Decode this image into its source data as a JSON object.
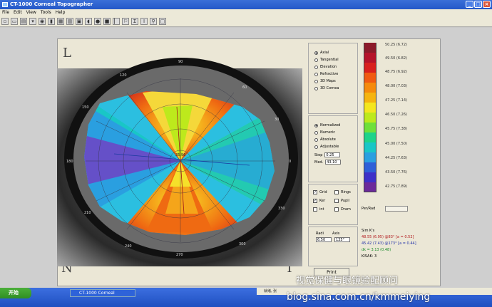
{
  "window": {
    "title": "CT-1000 Corneal Topographer"
  },
  "menu": [
    "File",
    "Edit",
    "View",
    "Tools",
    "Help"
  ],
  "corners": {
    "top_left": "L",
    "bottom_left": "N",
    "bottom_right": "T"
  },
  "map": {
    "axis_labels": [
      "90",
      "60",
      "30",
      "0",
      "330",
      "300",
      "270",
      "240",
      "210",
      "180",
      "150",
      "120"
    ],
    "center_label": "35.96"
  },
  "map_type": {
    "options": [
      "Axial",
      "Tangential",
      "Elevation",
      "Refractive",
      "3D Maps",
      "3D Cornea"
    ],
    "selected": "Axial"
  },
  "scale_type": {
    "options": [
      "Normalized",
      "Numeric",
      "Absolute",
      "Adjustable"
    ],
    "selected": "Normalized",
    "step_label": "Step",
    "step_value": "0.25",
    "med_label": "Med.",
    "med_value": "43.10"
  },
  "overlays": {
    "items": [
      {
        "label": "Grid",
        "checked": true
      },
      {
        "label": "Rings",
        "checked": false
      },
      {
        "label": "Ker",
        "checked": true
      },
      {
        "label": "Pupil",
        "checked": false
      },
      {
        "label": "int",
        "checked": false
      },
      {
        "label": "Dram",
        "checked": false
      }
    ]
  },
  "radi_axis": {
    "radi_label": "Radi",
    "axis_label": "Axis",
    "radi_value": "6.50",
    "axis_value": "135°"
  },
  "scale": {
    "entries": [
      {
        "d": "50.25",
        "mm": "(6.72)"
      },
      {
        "d": "49.50",
        "mm": "(6.82)"
      },
      {
        "d": "48.75",
        "mm": "(6.92)"
      },
      {
        "d": "48.00",
        "mm": "(7.03)"
      },
      {
        "d": "47.25",
        "mm": "(7.14)"
      },
      {
        "d": "46.50",
        "mm": "(7.26)"
      },
      {
        "d": "45.75",
        "mm": "(7.38)"
      },
      {
        "d": "45.00",
        "mm": "(7.50)"
      },
      {
        "d": "44.25",
        "mm": "(7.63)"
      },
      {
        "d": "43.50",
        "mm": "(7.76)"
      },
      {
        "d": "42.75",
        "mm": "(7.89)"
      }
    ],
    "colors": [
      "#8b1a2a",
      "#b5132a",
      "#d8201e",
      "#f05a12",
      "#f58a0c",
      "#f5b40f",
      "#f4e61e",
      "#bde91c",
      "#6fe03a",
      "#1ed38a",
      "#19c6c6",
      "#2a9fe0",
      "#2e5fd8",
      "#3d30c8",
      "#5a2eb0",
      "#6b2a9a"
    ]
  },
  "per_rad": {
    "label": "Per/Rad"
  },
  "sim_k": {
    "title": "Sim K's",
    "line1": "48.55 (6.95) @83°",
    "line1_tail": "[a = 0.52]",
    "line2": "45.42 (7.43) @173°",
    "line2_tail": "[a = 0.44]",
    "line3": "dk = 3.13 (0.48)",
    "line4": "KISAK: 3"
  },
  "print_button": "Print",
  "taskbar": {
    "start": "开始",
    "task": "CT-1000 Corneal"
  },
  "status": {
    "text": "就绪, 张"
  },
  "watermark": {
    "line1": "视觉保健与眼镜验配顾问",
    "line2": "blog.sina.com.cn/kmmeiying"
  }
}
